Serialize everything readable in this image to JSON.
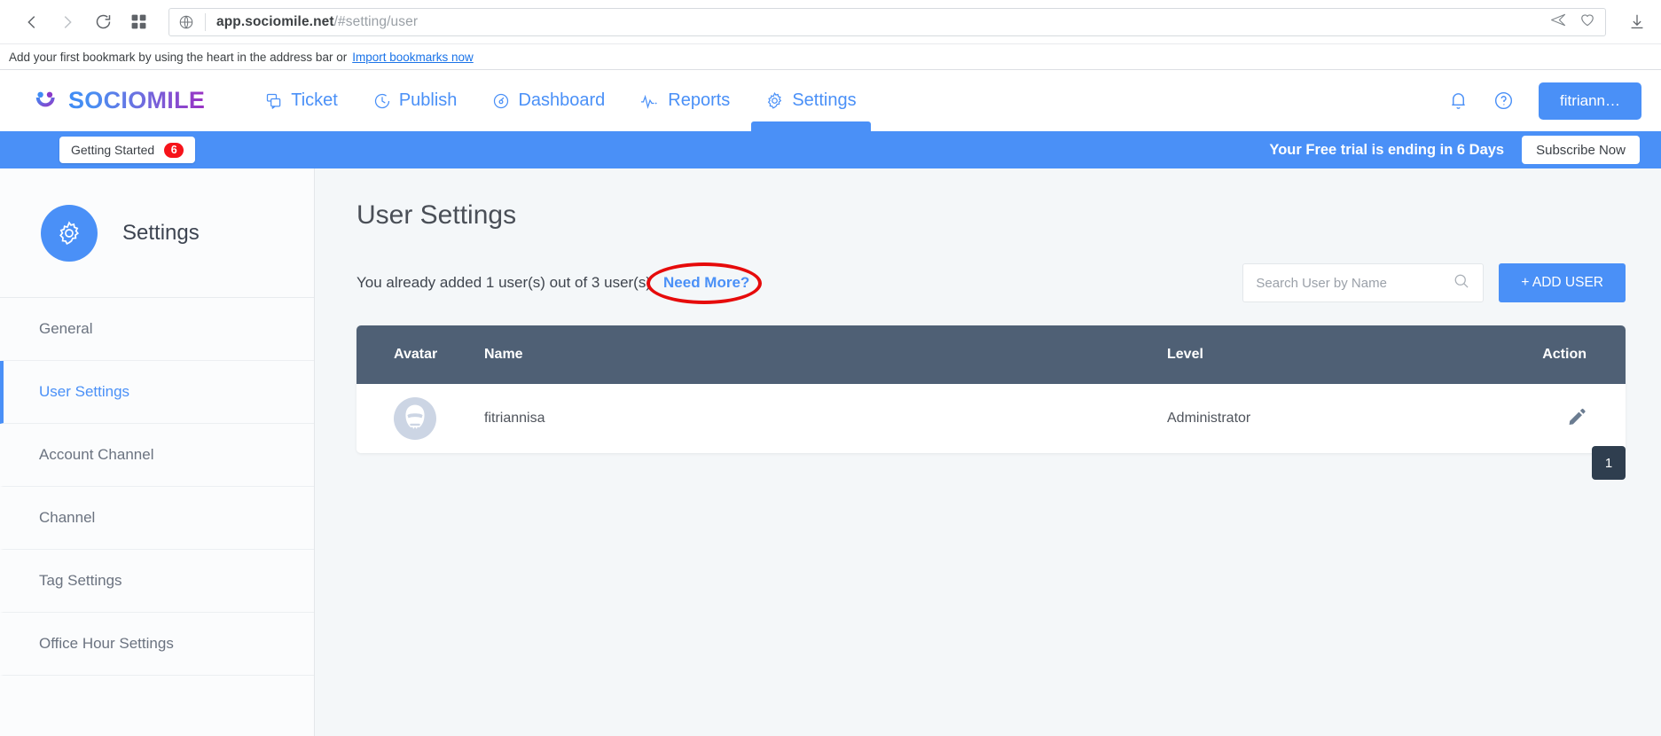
{
  "browser": {
    "back_icon": "chevron-left-icon",
    "forward_icon": "chevron-right-icon",
    "reload_icon": "reload-icon",
    "apps_icon": "grid-apps-icon",
    "url_domain": "app.sociomile.net",
    "url_path": "/#setting/user",
    "url_prefix": "app.",
    "send_icon": "send-arrow-icon",
    "heart_icon": "heart-icon",
    "download_icon": "download-icon",
    "bookmark_message": "Add your first bookmark by using the heart in the address bar or",
    "bookmark_link": "Import bookmarks now"
  },
  "header": {
    "logo_text": "SOCIOMILE",
    "nav": [
      {
        "label": "Ticket",
        "icon": "ticket-chat-icon",
        "active": false
      },
      {
        "label": "Publish",
        "icon": "clock-icon",
        "active": false
      },
      {
        "label": "Dashboard",
        "icon": "gauge-icon",
        "active": false
      },
      {
        "label": "Reports",
        "icon": "pulse-icon",
        "active": false
      },
      {
        "label": "Settings",
        "icon": "gear-icon",
        "active": true
      }
    ],
    "bell_icon": "bell-icon",
    "help_icon": "help-circle-icon",
    "user_button": "fitriann…"
  },
  "trial_banner": {
    "getting_started": "Getting Started",
    "getting_started_count": "6",
    "message": "Your Free trial is ending in 6 Days",
    "subscribe_label": "Subscribe Now",
    "background_color": "#4a90f7",
    "badge_color": "#f6131a"
  },
  "sidebar": {
    "title": "Settings",
    "icon": "gear-icon",
    "items": [
      {
        "label": "General",
        "active": false
      },
      {
        "label": "User Settings",
        "active": true
      },
      {
        "label": "Account Channel",
        "active": false
      },
      {
        "label": "Channel",
        "active": false
      },
      {
        "label": "Tag Settings",
        "active": false
      },
      {
        "label": "Office Hour Settings",
        "active": false
      }
    ]
  },
  "main": {
    "page_title": "User Settings",
    "quota_text": "You already added 1 user(s) out of 3 user(s)",
    "need_more_label": "Need More?",
    "annotation_color": "#e60b0b",
    "search_placeholder": "Search User by Name",
    "search_value": "",
    "search_icon": "search-icon",
    "add_user_label": "+ ADD USER",
    "accent_color": "#4a90f7",
    "table": {
      "header_bg": "#4f6075",
      "columns": [
        "Avatar",
        "Name",
        "Level",
        "Action"
      ],
      "rows": [
        {
          "avatar": "stormtrooper-avatar",
          "name": "fitriannisa",
          "level": "Administrator",
          "action_icon": "pencil-edit-icon"
        }
      ]
    },
    "pagination": {
      "current_page": "1"
    }
  }
}
